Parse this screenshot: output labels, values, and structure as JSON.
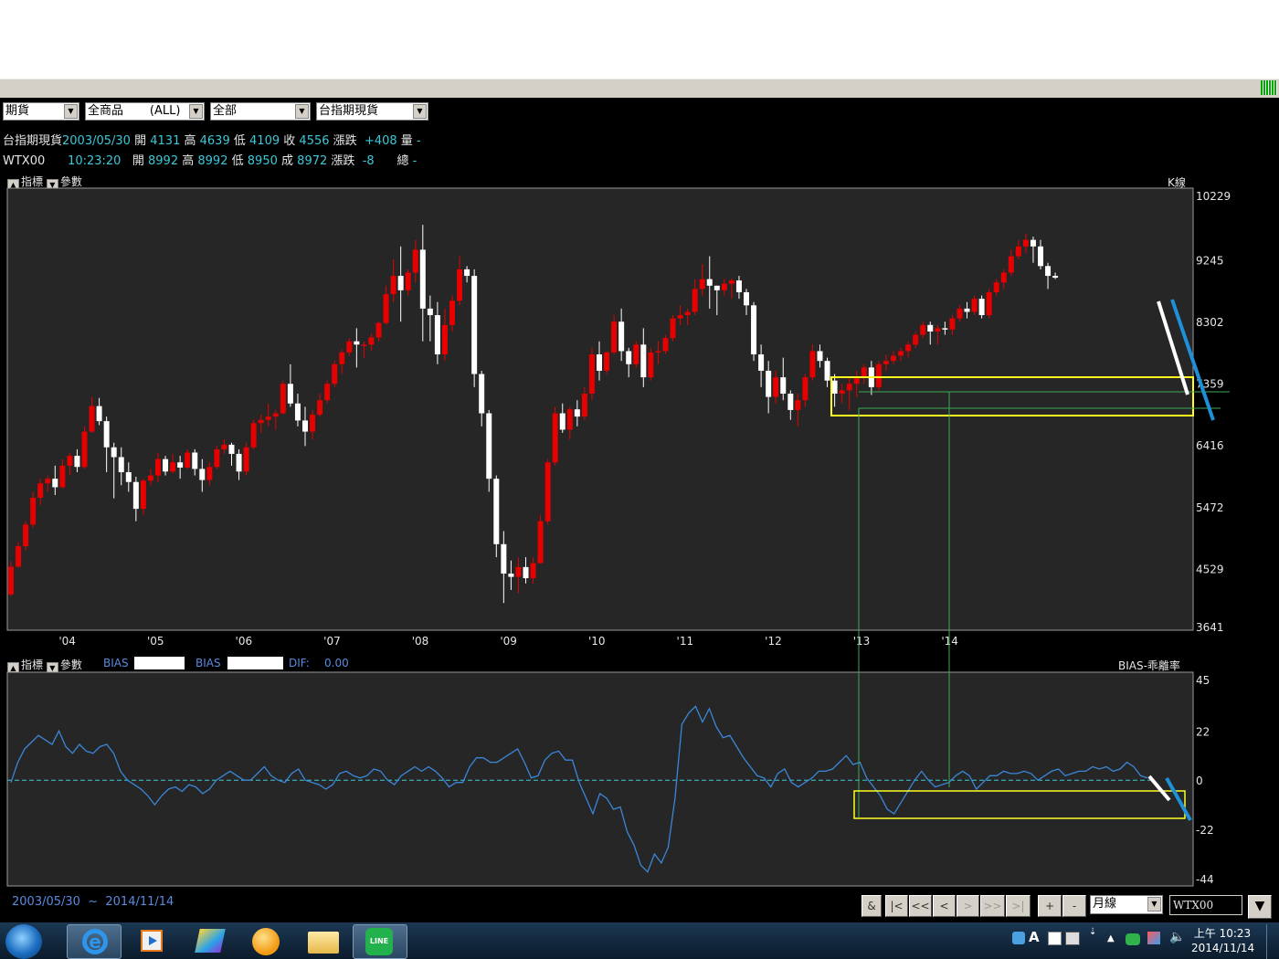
{
  "toolbar": {
    "combos": [
      "期貨",
      "全商品       (ALL)",
      "全部",
      "台指期現貨"
    ]
  },
  "quote_line1": {
    "name": "台指期現貨",
    "date": "2003/05/30",
    "open_label": "開",
    "open": "4131",
    "high_label": "高",
    "high": "4639",
    "low_label": "低",
    "low": "4109",
    "close_label": "收",
    "close": "4556",
    "chg_label": "漲跌",
    "chg": "+408",
    "vol_label": "量",
    "vol": "-"
  },
  "quote_line2": {
    "name": "WTX00",
    "time": "10:23:20",
    "open_label": "開",
    "open": "8992",
    "high_label": "高",
    "high": "8992",
    "low_label": "低",
    "low": "8950",
    "close_label": "成",
    "close": "8972",
    "chg_label": "漲跌",
    "chg": "-8",
    "vol_label": "總",
    "vol": "-"
  },
  "main_panel": {
    "indicator_label": "指標",
    "param_label": "參數",
    "kline_label": "K線"
  },
  "sub_panel": {
    "indicator_label": "指標",
    "param_label": "參數",
    "bias1_label": "BIAS",
    "bias2_label": "BIAS",
    "dif_label": "DIF:",
    "dif_value": "0.00",
    "name": "BIAS-乖離率"
  },
  "chart_data": [
    {
      "type": "candlestick",
      "interval": "月線",
      "y_ticks": [
        "10229",
        "9245",
        "8302",
        "7359",
        "6416",
        "5472",
        "4529",
        "3641"
      ],
      "ylim": [
        3641,
        10229
      ],
      "x_ticks": [
        "'04",
        "'05",
        "'06",
        "'07",
        "'08",
        "'09",
        "'10",
        "'11",
        "'12",
        "'13",
        "'14"
      ],
      "x_start": "2003/05",
      "colors": {
        "up": "#e60000",
        "down": "#ffffff"
      },
      "ohlc": [
        [
          4131,
          4639,
          4109,
          4556
        ],
        [
          4556,
          4930,
          4540,
          4870
        ],
        [
          4870,
          5250,
          4800,
          5200
        ],
        [
          5200,
          5700,
          5150,
          5610
        ],
        [
          5610,
          5900,
          5500,
          5830
        ],
        [
          5830,
          5950,
          5700,
          5900
        ],
        [
          5900,
          6100,
          5650,
          5770
        ],
        [
          5770,
          6200,
          5750,
          6100
        ],
        [
          6100,
          6300,
          5950,
          6250
        ],
        [
          6250,
          6350,
          6000,
          6080
        ],
        [
          6080,
          6700,
          6050,
          6620
        ],
        [
          6620,
          7150,
          6600,
          7010
        ],
        [
          7010,
          7135,
          6720,
          6780
        ],
        [
          6780,
          6850,
          6000,
          6380
        ],
        [
          6380,
          6450,
          5600,
          6230
        ],
        [
          6230,
          6380,
          5800,
          6000
        ],
        [
          6000,
          6150,
          5700,
          5850
        ],
        [
          5850,
          5930,
          5250,
          5440
        ],
        [
          5440,
          5900,
          5350,
          5870
        ],
        [
          5870,
          6050,
          5800,
          5950
        ],
        [
          5950,
          6300,
          5850,
          6200
        ],
        [
          6200,
          6250,
          5950,
          6010
        ],
        [
          6010,
          6280,
          5980,
          6150
        ],
        [
          6150,
          6250,
          5900,
          6070
        ],
        [
          6070,
          6350,
          6050,
          6300
        ],
        [
          6300,
          6350,
          5950,
          6050
        ],
        [
          6050,
          6200,
          5700,
          5880
        ],
        [
          5880,
          6150,
          5800,
          6080
        ],
        [
          6080,
          6400,
          6050,
          6350
        ],
        [
          6350,
          6500,
          6280,
          6420
        ],
        [
          6420,
          6450,
          6100,
          6280
        ],
        [
          6280,
          6350,
          5880,
          6010
        ],
        [
          6010,
          6450,
          5950,
          6380
        ],
        [
          6380,
          6800,
          6350,
          6750
        ],
        [
          6750,
          6880,
          6600,
          6800
        ],
        [
          6800,
          7050,
          6700,
          6850
        ],
        [
          6850,
          6950,
          6650,
          6900
        ],
        [
          6900,
          7400,
          6880,
          7350
        ],
        [
          7350,
          7650,
          7000,
          7050
        ],
        [
          7050,
          7200,
          6700,
          6790
        ],
        [
          6790,
          7000,
          6400,
          6620
        ],
        [
          6620,
          6950,
          6500,
          6880
        ],
        [
          6880,
          7200,
          6850,
          7100
        ],
        [
          7100,
          7400,
          7050,
          7350
        ],
        [
          7350,
          7700,
          7300,
          7650
        ],
        [
          7650,
          7880,
          7500,
          7830
        ],
        [
          7830,
          8050,
          7780,
          8000
        ],
        [
          8000,
          8200,
          7600,
          7950
        ],
        [
          7950,
          8000,
          7750,
          7950
        ],
        [
          7950,
          8120,
          7850,
          8060
        ],
        [
          8060,
          8300,
          8000,
          8280
        ],
        [
          8280,
          8850,
          8250,
          8720
        ],
        [
          8720,
          9250,
          8600,
          9000
        ],
        [
          9000,
          9450,
          8300,
          8780
        ],
        [
          8780,
          9100,
          8700,
          9050
        ],
        [
          9050,
          9550,
          8900,
          9400
        ],
        [
          9400,
          9780,
          8000,
          8500
        ],
        [
          8500,
          8700,
          8000,
          8400
        ],
        [
          8400,
          8600,
          7650,
          7800
        ],
        [
          7800,
          8500,
          7700,
          8250
        ],
        [
          8250,
          8700,
          8150,
          8620
        ],
        [
          8620,
          9300,
          8550,
          9100
        ],
        [
          9100,
          9150,
          8900,
          9000
        ],
        [
          9000,
          9100,
          7300,
          7500
        ],
        [
          7500,
          7550,
          6700,
          6900
        ],
        [
          6900,
          6950,
          5700,
          5900
        ],
        [
          5900,
          5950,
          4700,
          4900
        ],
        [
          4900,
          5100,
          4000,
          4450
        ],
        [
          4450,
          4650,
          4200,
          4400
        ],
        [
          4400,
          4700,
          4150,
          4550
        ],
        [
          4550,
          4700,
          4300,
          4380
        ],
        [
          4380,
          4700,
          4300,
          4610
        ],
        [
          4610,
          5350,
          4600,
          5250
        ],
        [
          5250,
          6200,
          5200,
          6150
        ],
        [
          6150,
          7000,
          6100,
          6900
        ],
        [
          6900,
          7050,
          6600,
          6650
        ],
        [
          6650,
          7000,
          6500,
          6960
        ],
        [
          6960,
          7100,
          6700,
          6850
        ],
        [
          6850,
          7300,
          6800,
          7200
        ],
        [
          7200,
          7900,
          7100,
          7800
        ],
        [
          7800,
          8000,
          7400,
          7550
        ],
        [
          7550,
          7850,
          7500,
          7830
        ],
        [
          7830,
          8400,
          7800,
          8300
        ],
        [
          8300,
          8500,
          7700,
          7850
        ],
        [
          7850,
          7900,
          7450,
          7650
        ],
        [
          7650,
          8000,
          7600,
          7950
        ],
        [
          7950,
          8200,
          7300,
          7450
        ],
        [
          7450,
          7900,
          7400,
          7830
        ],
        [
          7830,
          8000,
          7650,
          7850
        ],
        [
          7850,
          8100,
          7800,
          8050
        ],
        [
          8050,
          8400,
          8000,
          8350
        ],
        [
          8350,
          8550,
          8250,
          8400
        ],
        [
          8400,
          8500,
          8250,
          8450
        ],
        [
          8450,
          8950,
          8400,
          8800
        ],
        [
          8800,
          9180,
          8700,
          8950
        ],
        [
          8950,
          9300,
          8500,
          8850
        ],
        [
          8850,
          8850,
          8400,
          8780
        ],
        [
          8780,
          8950,
          8700,
          8880
        ],
        [
          8880,
          8960,
          8650,
          8930
        ],
        [
          8930,
          9000,
          8650,
          8750
        ],
        [
          8750,
          8800,
          8400,
          8550
        ],
        [
          8550,
          8600,
          7700,
          7800
        ],
        [
          7800,
          7950,
          7300,
          7550
        ],
        [
          7550,
          7700,
          6900,
          7150
        ],
        [
          7150,
          7550,
          7050,
          7450
        ],
        [
          7450,
          7750,
          7100,
          7200
        ],
        [
          7200,
          7250,
          6800,
          6950
        ],
        [
          6950,
          7200,
          6700,
          7100
        ],
        [
          7100,
          7500,
          7000,
          7450
        ],
        [
          7450,
          7950,
          7400,
          7850
        ],
        [
          7850,
          7950,
          7600,
          7700
        ],
        [
          7700,
          7750,
          7300,
          7400
        ],
        [
          7400,
          7500,
          7000,
          7200
        ],
        [
          7200,
          7350,
          7050,
          7250
        ],
        [
          7250,
          7450,
          6950,
          7350
        ],
        [
          7350,
          7550,
          7150,
          7450
        ],
        [
          7450,
          7650,
          7350,
          7600
        ],
        [
          7600,
          7700,
          7180,
          7300
        ],
        [
          7300,
          7700,
          7250,
          7650
        ],
        [
          7650,
          7800,
          7550,
          7700
        ],
        [
          7700,
          7850,
          7650,
          7780
        ],
        [
          7780,
          7900,
          7700,
          7850
        ],
        [
          7850,
          8000,
          7750,
          7950
        ],
        [
          7950,
          8150,
          7900,
          8100
        ],
        [
          8100,
          8300,
          8050,
          8250
        ],
        [
          8250,
          8300,
          7950,
          8150
        ],
        [
          8150,
          8250,
          7950,
          8200
        ],
        [
          8200,
          8300,
          8100,
          8180
        ],
        [
          8180,
          8400,
          8100,
          8350
        ],
        [
          8350,
          8550,
          8300,
          8500
        ],
        [
          8500,
          8600,
          8350,
          8450
        ],
        [
          8450,
          8700,
          8400,
          8650
        ],
        [
          8650,
          8700,
          8350,
          8400
        ],
        [
          8400,
          8800,
          8350,
          8750
        ],
        [
          8750,
          8950,
          8700,
          8900
        ],
        [
          8900,
          9100,
          8800,
          9050
        ],
        [
          9050,
          9400,
          9000,
          9300
        ],
        [
          9300,
          9550,
          9250,
          9450
        ],
        [
          9450,
          9650,
          9350,
          9550
        ],
        [
          9550,
          9600,
          9200,
          9450
        ],
        [
          9450,
          9550,
          9100,
          9150
        ],
        [
          9150,
          9200,
          8800,
          9000
        ],
        [
          9000,
          9050,
          8950,
          8972
        ]
      ]
    },
    {
      "type": "line",
      "name": "BIAS-乖離率",
      "y_ticks": [
        "45",
        "22",
        "0",
        "-22",
        "-44"
      ],
      "ylim": [
        -44,
        45
      ],
      "baseline": 0,
      "values": [
        -1,
        8,
        14,
        17,
        20,
        18,
        16,
        22,
        15,
        12,
        16,
        13,
        12,
        15,
        16,
        12,
        4,
        0,
        -2,
        -4,
        -7,
        -11,
        -7,
        -4,
        -3,
        -5,
        -2,
        -3,
        -6,
        -4,
        0,
        2,
        4,
        2,
        0,
        0,
        3,
        6,
        2,
        0,
        -1,
        3,
        5,
        0,
        -1,
        -2,
        -4,
        -2,
        3,
        4,
        2,
        1,
        2,
        5,
        4,
        0,
        -2,
        2,
        4,
        6,
        4,
        6,
        4,
        1,
        -3,
        -1,
        -1,
        6,
        10,
        10,
        8,
        8,
        10,
        12,
        14,
        8,
        1,
        2,
        9,
        12,
        13,
        9,
        9,
        -1,
        -8,
        -15,
        -6,
        -8,
        -13,
        -12,
        -23,
        -29,
        -38,
        -41,
        -33,
        -37,
        -30,
        -8,
        25,
        30,
        33,
        26,
        32,
        24,
        19,
        20,
        15,
        10,
        6,
        2,
        1,
        -3,
        3,
        5,
        -1,
        -3,
        -1,
        1,
        4,
        4,
        5,
        8,
        11,
        7,
        8,
        1,
        -3,
        -7,
        -13,
        -15,
        -10,
        -5,
        0,
        4,
        0,
        -3,
        -2,
        -1,
        2,
        4,
        2,
        -4,
        -1,
        2,
        2,
        4,
        3,
        3,
        4,
        3,
        0,
        2,
        4,
        5,
        2,
        3,
        4,
        4,
        6,
        5,
        6,
        4,
        5,
        8,
        6,
        2,
        1
      ]
    }
  ],
  "date_range": {
    "from": "2003/05/30",
    "sep": "~",
    "to": "2014/11/14"
  },
  "nav": {
    "buttons": [
      "&",
      "|<",
      "<<",
      "<",
      ">",
      ">>",
      ">|",
      "+",
      "-"
    ],
    "interval": "月線",
    "symbol": "WTX00"
  },
  "taskbar": {
    "time": "上午 10:23",
    "date": "2014/11/14",
    "ime": "A",
    "apps": [
      "start-icon",
      "ie-icon",
      "media-player-icon",
      "paint-icon",
      "orange-app-icon",
      "folder-icon",
      "line-icon"
    ]
  }
}
